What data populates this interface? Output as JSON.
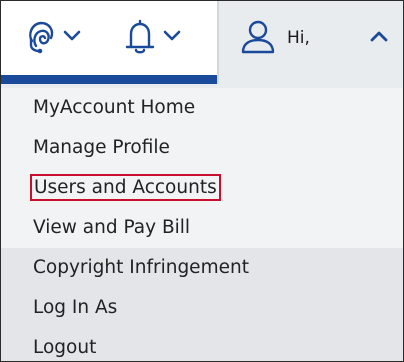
{
  "header": {
    "support_icon": "support-headset-icon",
    "bell_icon": "bell-icon",
    "user_icon": "user-icon",
    "greeting": "Hi,",
    "accent_color": "#1a4a9a",
    "highlight_color": "#c8102e"
  },
  "menu": {
    "items": [
      {
        "label": "MyAccount Home"
      },
      {
        "label": "Manage Profile"
      },
      {
        "label": "Users and Accounts",
        "highlighted": true
      },
      {
        "label": "View and Pay Bill"
      },
      {
        "label": "Copyright Infringement"
      },
      {
        "label": "Log In As"
      },
      {
        "label": "Logout"
      }
    ]
  }
}
